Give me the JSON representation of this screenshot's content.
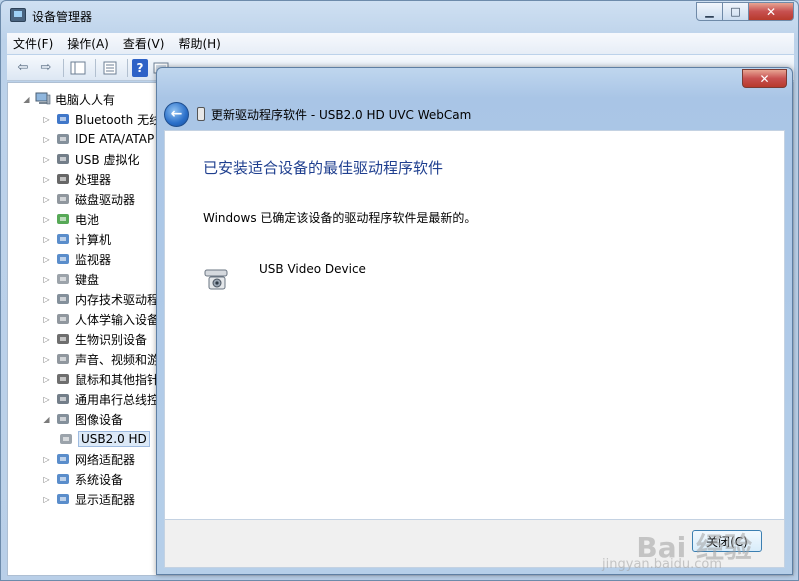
{
  "window": {
    "title": "设备管理器",
    "minimize_glyph": "▁",
    "maximize_glyph": "□",
    "close_glyph": "✕"
  },
  "menu": [
    "文件(F)",
    "操作(A)",
    "查看(V)",
    "帮助(H)"
  ],
  "toolbar": {
    "back_glyph": "⇦",
    "forward_glyph": "⇨",
    "help_glyph": "?"
  },
  "tree": {
    "root": "电脑人人有",
    "categories": [
      {
        "label": "Bluetooth 无线",
        "icon": "bluetooth-icon"
      },
      {
        "label": "IDE ATA/ATAP",
        "icon": "ide-controller-icon"
      },
      {
        "label": "USB 虚拟化",
        "icon": "usb-icon"
      },
      {
        "label": "处理器",
        "icon": "processor-icon"
      },
      {
        "label": "磁盘驱动器",
        "icon": "disk-drive-icon"
      },
      {
        "label": "电池",
        "icon": "battery-icon"
      },
      {
        "label": "计算机",
        "icon": "computer-icon"
      },
      {
        "label": "监视器",
        "icon": "monitor-icon"
      },
      {
        "label": "键盘",
        "icon": "keyboard-icon"
      },
      {
        "label": "内存技术驱动程",
        "icon": "memory-icon"
      },
      {
        "label": "人体学输入设备",
        "icon": "hid-icon"
      },
      {
        "label": "生物识别设备",
        "icon": "fingerprint-icon"
      },
      {
        "label": "声音、视频和游",
        "icon": "speaker-icon"
      },
      {
        "label": "鼠标和其他指针",
        "icon": "mouse-icon"
      },
      {
        "label": "通用串行总线控",
        "icon": "usb-controller-icon"
      },
      {
        "label": "图像设备",
        "icon": "imaging-device-icon"
      },
      {
        "label": "USB2.0 HD",
        "icon": "webcam-icon"
      },
      {
        "label": "网络适配器",
        "icon": "network-adapter-icon"
      },
      {
        "label": "系统设备",
        "icon": "system-device-icon"
      },
      {
        "label": "显示适配器",
        "icon": "display-adapter-icon"
      }
    ]
  },
  "dialog": {
    "close_glyph": "✕",
    "back_glyph": "←",
    "header_title": "更新驱动程序软件 - USB2.0 HD UVC WebCam",
    "heading": "已安装适合设备的最佳驱动程序软件",
    "description": "Windows 已确定该设备的驱动程序软件是最新的。",
    "device_name": "USB Video Device",
    "close_button": "关闭(C)"
  },
  "watermark": {
    "brand": "Bai 经验",
    "url": "jingyan.baidu.com"
  },
  "colors": {
    "heading": "#1f3f8f",
    "selection": "#dce9f7"
  }
}
